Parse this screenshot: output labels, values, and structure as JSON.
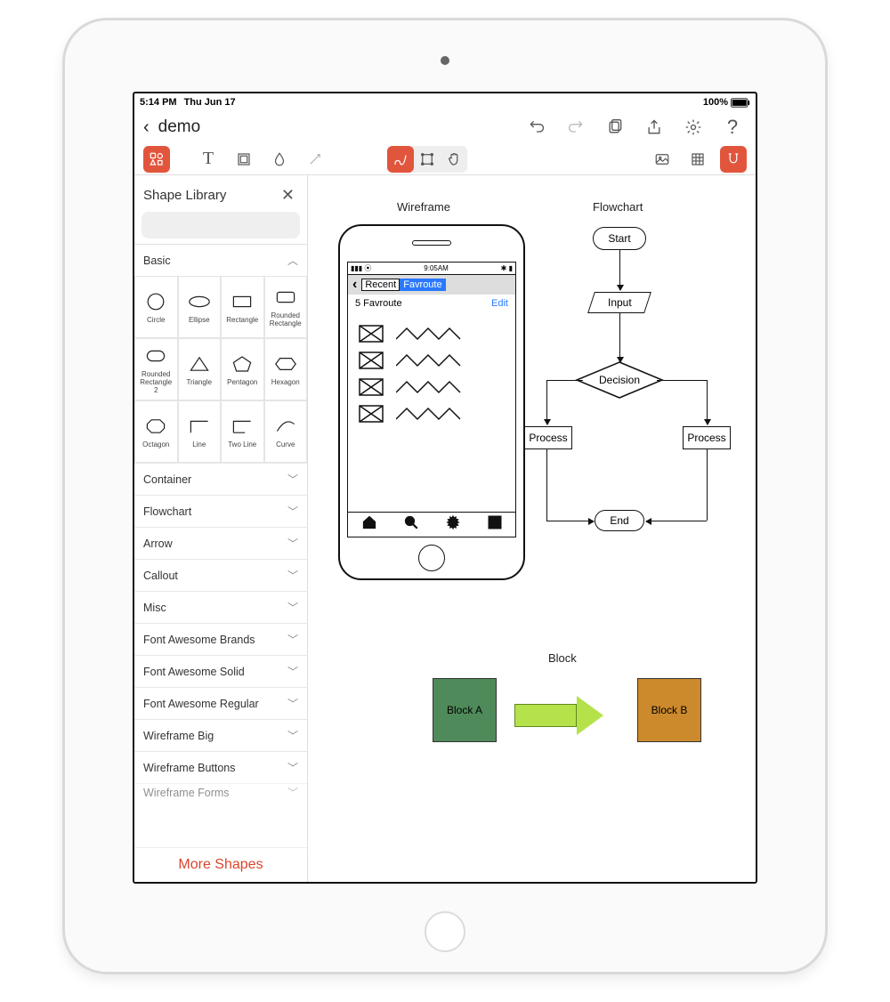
{
  "device": {
    "orientation": "portrait"
  },
  "ios_status": {
    "time": "5:14 PM",
    "date": "Thu Jun 17",
    "battery": "100%"
  },
  "header": {
    "back": "‹",
    "document_name": "demo",
    "actions": {
      "undo": "undo",
      "redo": "redo",
      "pages": "pages",
      "share": "share",
      "settings": "settings",
      "help": "?"
    }
  },
  "toolbar": {
    "shapes_panel": "shapes",
    "text": "T",
    "fill": "fill",
    "drop": "drop",
    "connector": "connector",
    "draw": "draw",
    "select": "select",
    "pan": "pan",
    "image": "image",
    "grid": "grid",
    "magnet": "magnet"
  },
  "sidebar": {
    "title": "Shape Library",
    "search_placeholder": "",
    "more": "More Shapes",
    "basic_label": "Basic",
    "basic_shapes": [
      {
        "name": "Circle"
      },
      {
        "name": "Ellipse"
      },
      {
        "name": "Rectangle"
      },
      {
        "name": "Rounded Rectangle"
      },
      {
        "name": "Rounded Rectangle 2"
      },
      {
        "name": "Triangle"
      },
      {
        "name": "Pentagon"
      },
      {
        "name": "Hexagon"
      },
      {
        "name": "Octagon"
      },
      {
        "name": "Line"
      },
      {
        "name": "Two Line"
      },
      {
        "name": "Curve"
      }
    ],
    "categories": [
      "Container",
      "Flowchart",
      "Arrow",
      "Callout",
      "Misc",
      "Font Awesome Brands",
      "Font Awesome Solid",
      "Font Awesome Regular",
      "Wireframe Big",
      "Wireframe Buttons",
      "Wireframe Forms"
    ]
  },
  "canvas": {
    "labels": {
      "wireframe": "Wireframe",
      "flowchart": "Flowchart",
      "block": "Block"
    },
    "wireframe": {
      "status_time": "9:05AM",
      "nav_back": "‹",
      "tab_recent": "Recent",
      "tab_fav": "Favroute",
      "subheader": "5 Favroute",
      "edit": "Edit",
      "rows": 4
    },
    "flowchart": {
      "start": "Start",
      "input": "Input",
      "decision": "Decision",
      "process": "Process",
      "end": "End"
    },
    "block": {
      "a": "Block A",
      "b": "Block B"
    }
  }
}
